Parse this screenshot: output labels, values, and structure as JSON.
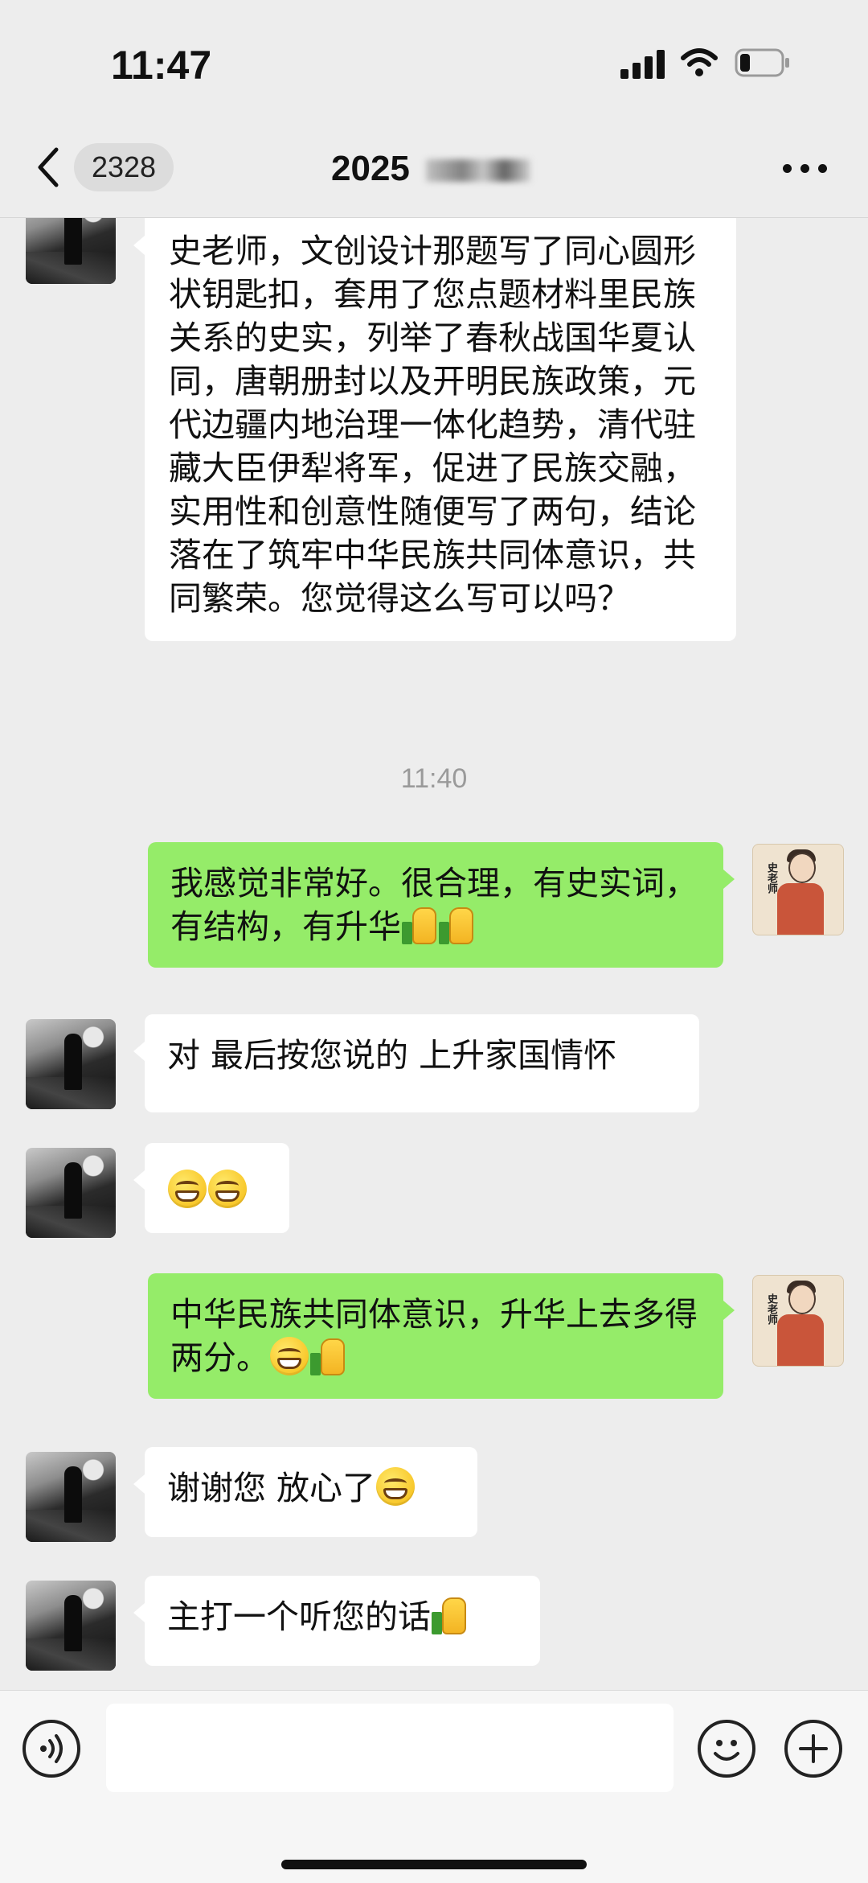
{
  "status_bar": {
    "time": "11:47"
  },
  "nav": {
    "unread_count": "2328",
    "title": "2025"
  },
  "messages": [
    {
      "side": "in",
      "text": "史老师，文创设计那题写了同心圆形状钥匙扣，套用了您点题材料里民族关系的史实，列举了春秋战国华夏认同，唐朝册封以及开明民族政策，元代边疆内地治理一体化趋势，清代驻藏大臣伊犁将军，促进了民族交融，实用性和创意性随便写了两句，结论落在了筑牢中华民族共同体意识，共同繁荣。您觉得这么写可以吗？"
    },
    {
      "side": "time",
      "text": "11:40"
    },
    {
      "side": "out",
      "text": "我感觉非常好。很合理，有史实词，有结构，有升华",
      "emojis": [
        "thumbs-up",
        "thumbs-up"
      ]
    },
    {
      "side": "in",
      "text": "对 最后按您说的 上升家国情怀"
    },
    {
      "side": "in",
      "text": "",
      "emojis": [
        "grin",
        "grin"
      ]
    },
    {
      "side": "out",
      "text": "中华民族共同体意识，升华上去多得两分。",
      "emojis": [
        "grin",
        "thumbs-up"
      ]
    },
    {
      "side": "in",
      "text": "谢谢您 放心了",
      "emojis": [
        "grin"
      ]
    },
    {
      "side": "in",
      "text": "主打一个听您的话",
      "emojis": [
        "thumbs-up"
      ]
    }
  ],
  "self_avatar": {
    "label": "史老师"
  },
  "colors": {
    "background": "#ededed",
    "incoming_bubble": "#ffffff",
    "outgoing_bubble": "#95ec69",
    "timestamp": "#9a9a9a"
  },
  "icons": {
    "back": "chevron-left-icon",
    "more": "more-dots-icon",
    "voice": "voice-icon",
    "emoji": "emoji-icon",
    "plus": "plus-icon"
  }
}
